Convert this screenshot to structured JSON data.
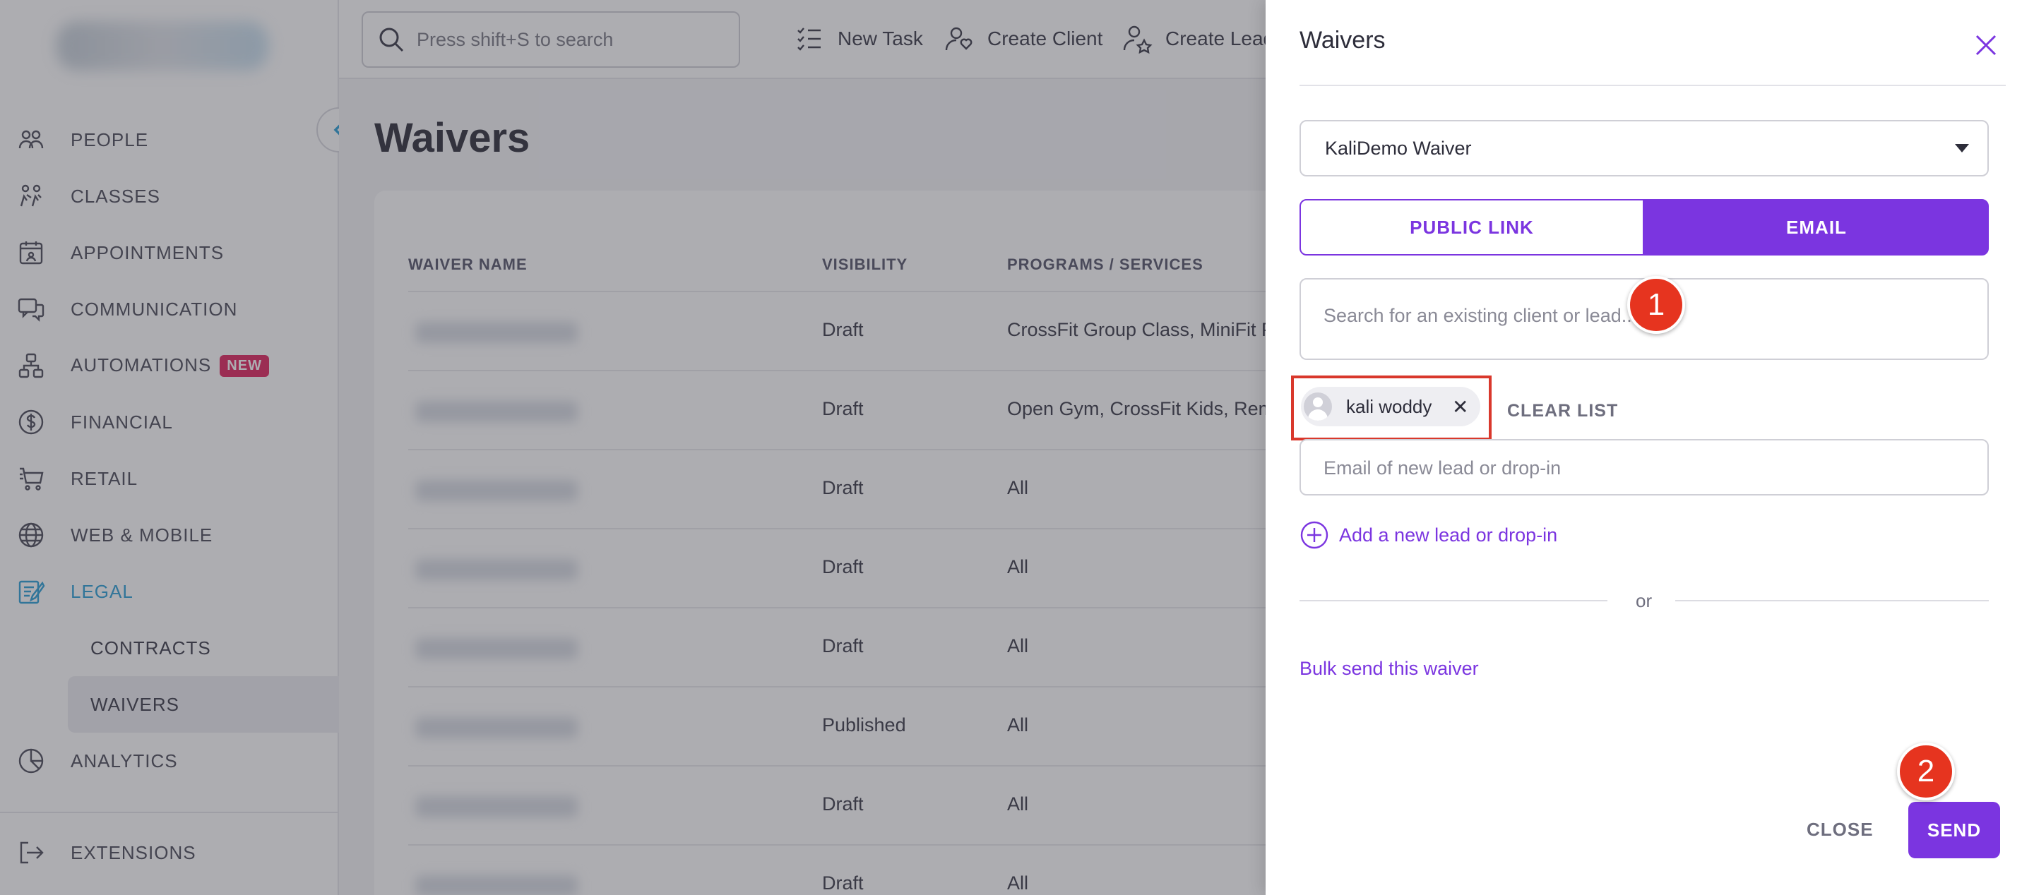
{
  "sidebar": {
    "items": [
      {
        "label": "PEOPLE",
        "icon": "people-icon"
      },
      {
        "label": "CLASSES",
        "icon": "classes-icon"
      },
      {
        "label": "APPOINTMENTS",
        "icon": "appointments-icon"
      },
      {
        "label": "COMMUNICATION",
        "icon": "communication-icon"
      },
      {
        "label": "AUTOMATIONS",
        "icon": "automations-icon",
        "badge": "NEW"
      },
      {
        "label": "FINANCIAL",
        "icon": "financial-icon"
      },
      {
        "label": "RETAIL",
        "icon": "retail-icon"
      },
      {
        "label": "WEB & MOBILE",
        "icon": "globe-icon"
      },
      {
        "label": "LEGAL",
        "icon": "legal-icon",
        "active": true
      },
      {
        "label": "ANALYTICS",
        "icon": "analytics-icon"
      },
      {
        "label": "EXTENSIONS",
        "icon": "extensions-icon"
      }
    ],
    "sub_items": [
      {
        "label": "CONTRACTS"
      },
      {
        "label": "WAIVERS",
        "active": true
      }
    ]
  },
  "topbar": {
    "search_placeholder": "Press shift+S to search",
    "actions": [
      "New Task",
      "Create Client",
      "Create Lead"
    ]
  },
  "main": {
    "title": "Waivers",
    "columns": [
      "WAIVER NAME",
      "VISIBILITY",
      "PROGRAMS / SERVICES"
    ],
    "rows": [
      {
        "visibility": "Draft",
        "programs": "CrossFit Group Class, MiniFit Pro"
      },
      {
        "visibility": "Draft",
        "programs": "Open Gym, CrossFit Kids, Remot"
      },
      {
        "visibility": "Draft",
        "programs": "All"
      },
      {
        "visibility": "Draft",
        "programs": "All"
      },
      {
        "visibility": "Draft",
        "programs": "All"
      },
      {
        "visibility": "Published",
        "programs": "All"
      },
      {
        "visibility": "Draft",
        "programs": "All"
      },
      {
        "visibility": "Draft",
        "programs": "All"
      }
    ]
  },
  "panel": {
    "title": "Waivers",
    "waiver_select": "KaliDemo Waiver",
    "toggle": {
      "public_link": "PUBLIC LINK",
      "email": "EMAIL",
      "selected": "EMAIL"
    },
    "client_search_placeholder": "Search for an existing client or lead...",
    "selected_chip": "kali woddy",
    "clear_list": "CLEAR LIST",
    "email_placeholder": "Email of new lead or drop-in",
    "add_lead": "Add a new lead or drop-in",
    "or": "or",
    "bulk_send": "Bulk send this waiver",
    "close": "CLOSE",
    "send": "SEND"
  },
  "markers": {
    "one": "1",
    "two": "2"
  },
  "colors": {
    "accent": "#7b35e0",
    "active_nav": "#2a9fd6",
    "marker": "#e6341f",
    "badge": "#e0245e"
  }
}
